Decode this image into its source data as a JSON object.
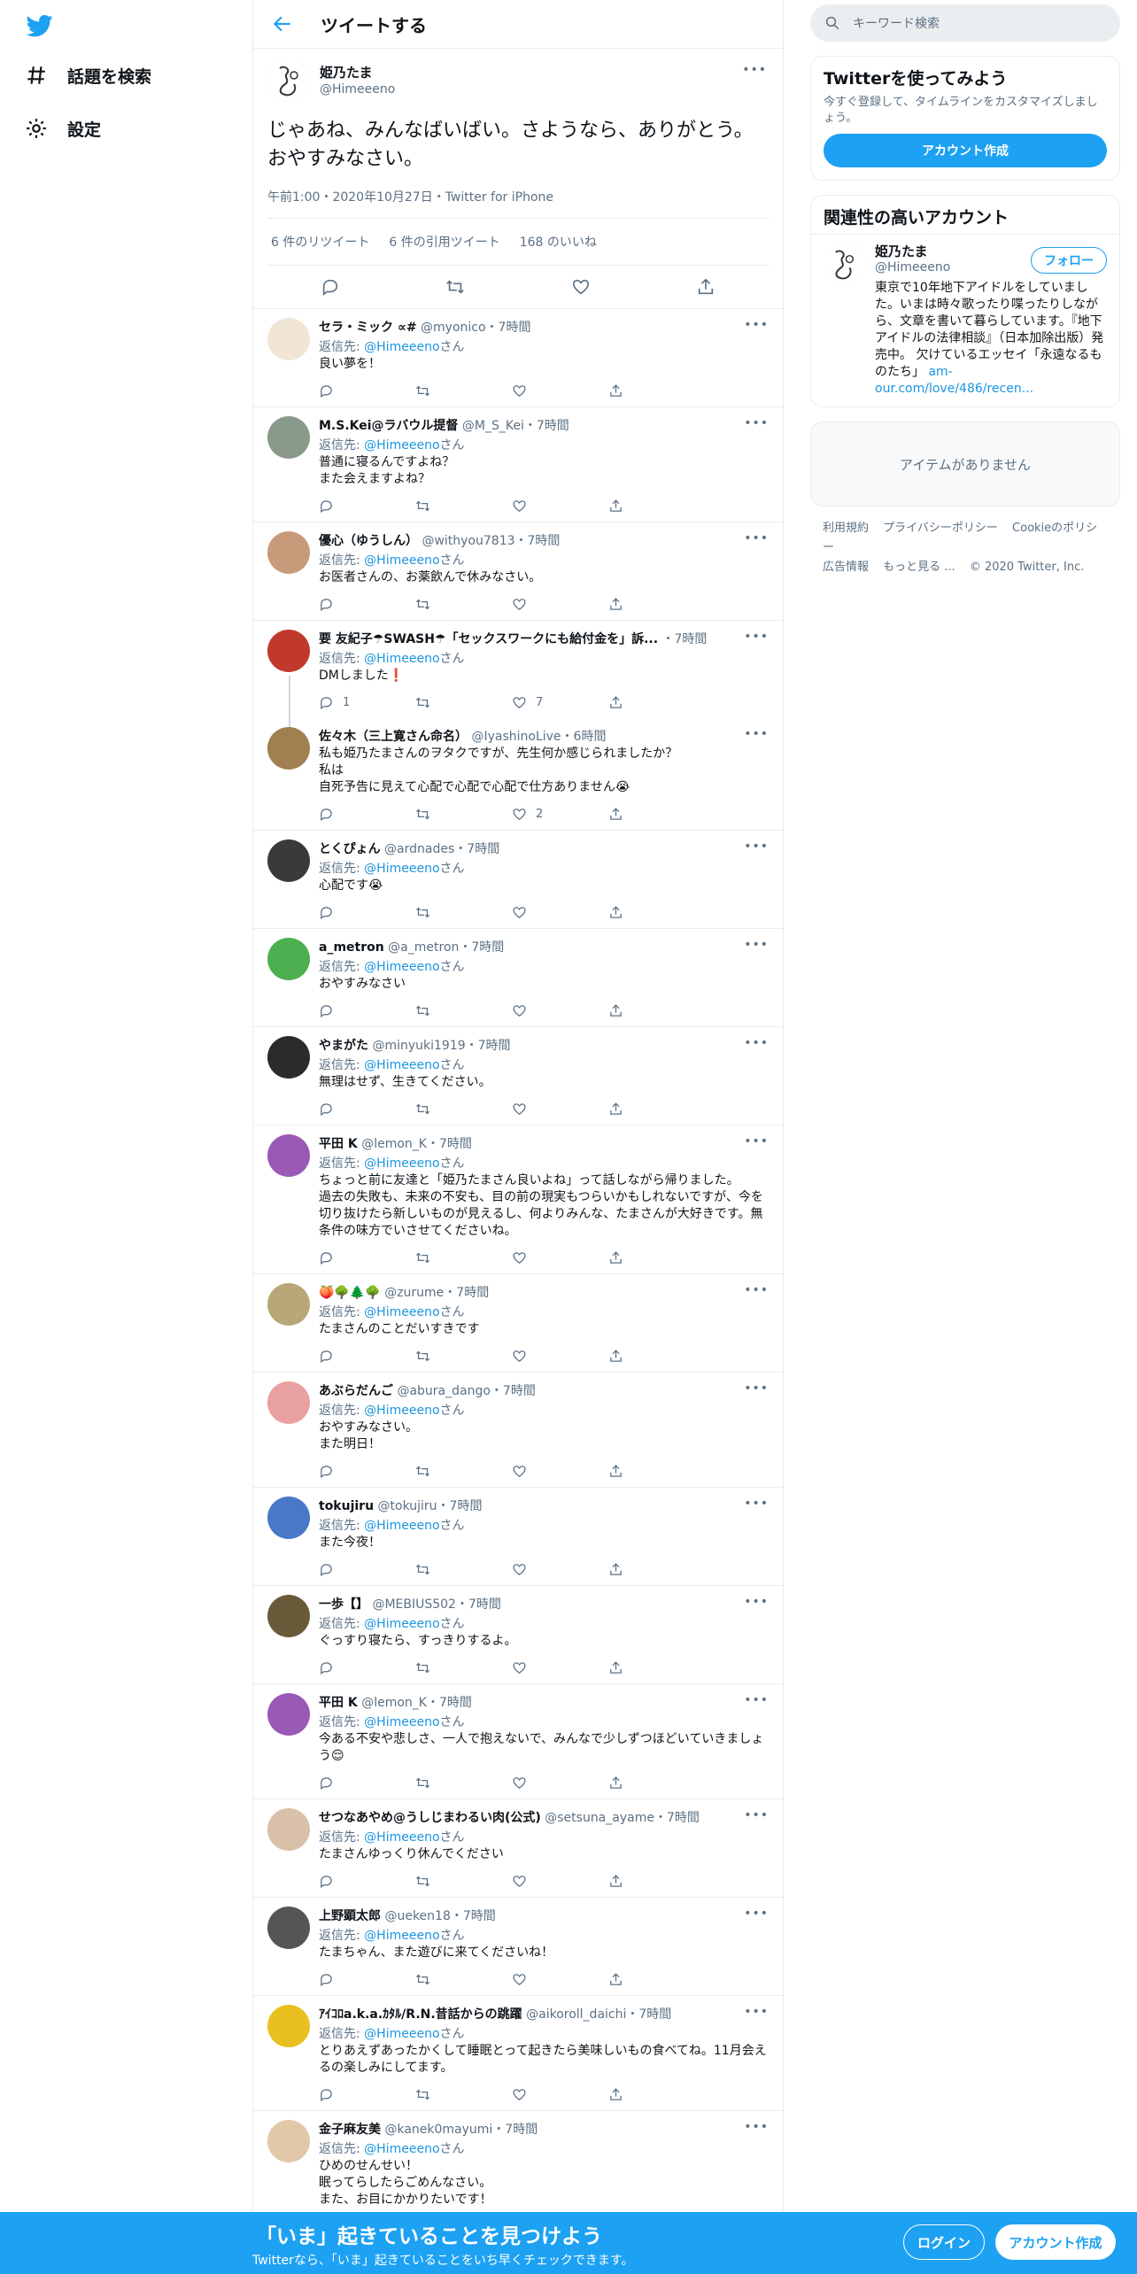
{
  "nav": {
    "explore": "話題を検索",
    "settings": "設定"
  },
  "header": {
    "title": "ツイートする"
  },
  "focal": {
    "name": "姫乃たま",
    "handle": "@Himeeeno",
    "text": "じゃあね、みんなばいばい。さようなら、ありがとう。おやすみなさい。",
    "meta": "午前1:00・2020年10月27日・Twitter for iPhone",
    "retweets": "6 件のリツイート",
    "quotes": "6 件の引用ツイート",
    "likes": "168 のいいね"
  },
  "reply_prefix": "返信先: ",
  "reply_suffix": "さん",
  "replies": [
    {
      "name": "セラ・ミック ∝#",
      "handle": "@myonico",
      "time": "・7時間",
      "to": "@Himeeeno",
      "text": "良い夢を！",
      "counts": [
        "",
        "",
        "",
        ""
      ],
      "avatar": "#f1e6d6"
    },
    {
      "name": "M.S.Kei@ラバウル提督",
      "handle": "@M_S_Kei",
      "time": "・7時間",
      "to": "@Himeeeno",
      "text": "普通に寝るんですよね？\nまた会えますよね？",
      "counts": [
        "",
        "",
        "",
        ""
      ],
      "avatar": "#8a9a8a"
    },
    {
      "name": "優心（ゆうしん）",
      "handle": "@withyou7813",
      "time": "・7時間",
      "to": "@Himeeeno",
      "text": "お医者さんの、お薬飲んで休みなさい。",
      "counts": [
        "",
        "",
        "",
        ""
      ],
      "avatar": "#c79a7a"
    },
    {
      "name": "要 友紀子☂SWASH☂「セックスワークにも給付金を」訴...",
      "handle": "",
      "time": "・7時間",
      "to": "@Himeeeno",
      "text": "DMしました❗",
      "counts": [
        "1",
        "",
        "7",
        ""
      ],
      "avatar": "#c0392b",
      "thread": true
    },
    {
      "name": "佐々木（三上寛さん命名）",
      "handle": "@IyashinoLive",
      "time": "・6時間",
      "to": "",
      "text": "私も姫乃たまさんのヲタクですが、先生何か感じられましたか？\n私は\n自死予告に見えて心配で心配で心配で仕方ありません😭",
      "counts": [
        "",
        "",
        "2",
        ""
      ],
      "avatar": "#a08050"
    },
    {
      "name": "とくぴょん",
      "handle": "@ardnades",
      "time": "・7時間",
      "to": "@Himeeeno",
      "text": "心配です😭",
      "counts": [
        "",
        "",
        "",
        ""
      ],
      "avatar": "#3a3a3a"
    },
    {
      "name": "a_metron",
      "handle": "@a_metron",
      "time": "・7時間",
      "to": "@Himeeeno",
      "text": "おやすみなさい",
      "counts": [
        "",
        "",
        "",
        ""
      ],
      "avatar": "#4caf50"
    },
    {
      "name": "やまがた",
      "handle": "@minyuki1919",
      "time": "・7時間",
      "to": "@Himeeeno",
      "text": "無理はせず、生きてください。",
      "counts": [
        "",
        "",
        "",
        ""
      ],
      "avatar": "#2b2b2b"
    },
    {
      "name": "平田 K",
      "handle": "@lemon_K",
      "time": "・7時間",
      "to": "@Himeeeno",
      "text": "ちょっと前に友達と「姫乃たまさん良いよね」って話しながら帰りました。\n過去の失敗も、未来の不安も、目の前の現実もつらいかもしれないですが、今を切り抜けたら新しいものが見えるし、何よりみんな、たまさんが大好きです。無条件の味方でいさせてくださいね。",
      "counts": [
        "",
        "",
        "",
        ""
      ],
      "avatar": "#9b59b6"
    },
    {
      "name": "🍑🌳🌲🌳",
      "handle": "@zurume",
      "time": "・7時間",
      "to": "@Himeeeno",
      "text": "たまさんのことだいすきです",
      "counts": [
        "",
        "",
        "",
        ""
      ],
      "avatar": "#b8a878"
    },
    {
      "name": "あぶらだんご",
      "handle": "@abura_dango",
      "time": "・7時間",
      "to": "@Himeeeno",
      "text": "おやすみなさい。\nまた明日！",
      "counts": [
        "",
        "",
        "",
        ""
      ],
      "avatar": "#e8a0a0"
    },
    {
      "name": "tokujiru",
      "handle": "@tokujiru",
      "time": "・7時間",
      "to": "@Himeeeno",
      "text": "また今夜！",
      "counts": [
        "",
        "",
        "",
        ""
      ],
      "avatar": "#4a78c8"
    },
    {
      "name": "一歩【】",
      "handle": "@MEBIUS502",
      "time": "・7時間",
      "to": "@Himeeeno",
      "text": "ぐっすり寝たら、すっきりするよ。",
      "counts": [
        "",
        "",
        "",
        ""
      ],
      "avatar": "#6b5a3a"
    },
    {
      "name": "平田 K",
      "handle": "@lemon_K",
      "time": "・7時間",
      "to": "@Himeeeno",
      "text": "今ある不安や悲しさ、一人で抱えないで、みんなで少しずつほどいていきましょう😌",
      "counts": [
        "",
        "",
        "",
        ""
      ],
      "avatar": "#9b59b6"
    },
    {
      "name": "せつなあやめ@うしじまわるい肉(公式)",
      "handle": "@setsuna_ayame",
      "time": "・7時間",
      "to": "@Himeeeno",
      "text": "たまさんゆっくり休んでください",
      "counts": [
        "",
        "",
        "",
        ""
      ],
      "avatar": "#d9c0a8"
    },
    {
      "name": "上野顕太郎",
      "handle": "@ueken18",
      "time": "・7時間",
      "to": "@Himeeeno",
      "text": "たまちゃん、また遊びに来てくださいね！",
      "counts": [
        "",
        "",
        "",
        ""
      ],
      "avatar": "#555555"
    },
    {
      "name": "ｱｲｺﾛa.k.a.ｶﾀﾙ/R.N.昔話からの跳躍",
      "handle": "@aikoroll_daichi",
      "time": "・7時間",
      "to": "@Himeeeno",
      "text": "とりあえずあったかくして睡眠とって起きたら美味しいもの食べてね。11月会えるの楽しみにしてます。",
      "counts": [
        "",
        "",
        "",
        ""
      ],
      "avatar": "#e8c020"
    },
    {
      "name": "金子麻友美",
      "handle": "@kanek0mayumi",
      "time": "・7時間",
      "to": "@Himeeeno",
      "text": "ひめのせんせい！\n眠ってらしたらごめんなさい。\nまた、お目にかかりたいです！",
      "counts": [
        "",
        "",
        "",
        ""
      ],
      "avatar": "#e0c8a8"
    }
  ],
  "search": {
    "placeholder": "キーワード検索"
  },
  "signup_card": {
    "title": "Twitterを使ってみよう",
    "desc": "今すぐ登録して、タイムラインをカスタマイズしましょう。",
    "button": "アカウント作成"
  },
  "related": {
    "title": "関連性の高いアカウント",
    "name": "姫乃たま",
    "handle": "@Himeeeno",
    "follow": "フォロー",
    "bio": "東京で10年地下アイドルをしていました。いまは時々歌ったり喋ったりしながら、文章を書いて暮らしています。『地下アイドルの法律相談』（日本加除出版）発売中。 欠けているエッセイ「永遠なるものたち」",
    "bio_link": "am-our.com/love/486/recen..."
  },
  "empty": "アイテムがありません",
  "footer": {
    "terms": "利用規約",
    "privacy": "プライバシーポリシー",
    "cookie": "Cookieのポリシー",
    "ads": "広告情報",
    "more": "もっと見る ...",
    "copyright": "© 2020 Twitter, Inc."
  },
  "banner": {
    "title": "「いま」起きていることを見つけよう",
    "sub": "Twitterなら、「いま」起きていることをいち早くチェックできます。",
    "login": "ログイン",
    "signup": "アカウント作成"
  },
  "colors": {
    "accent": "#1da1f2",
    "link": "#1b95e0",
    "muted": "#5b7083"
  }
}
